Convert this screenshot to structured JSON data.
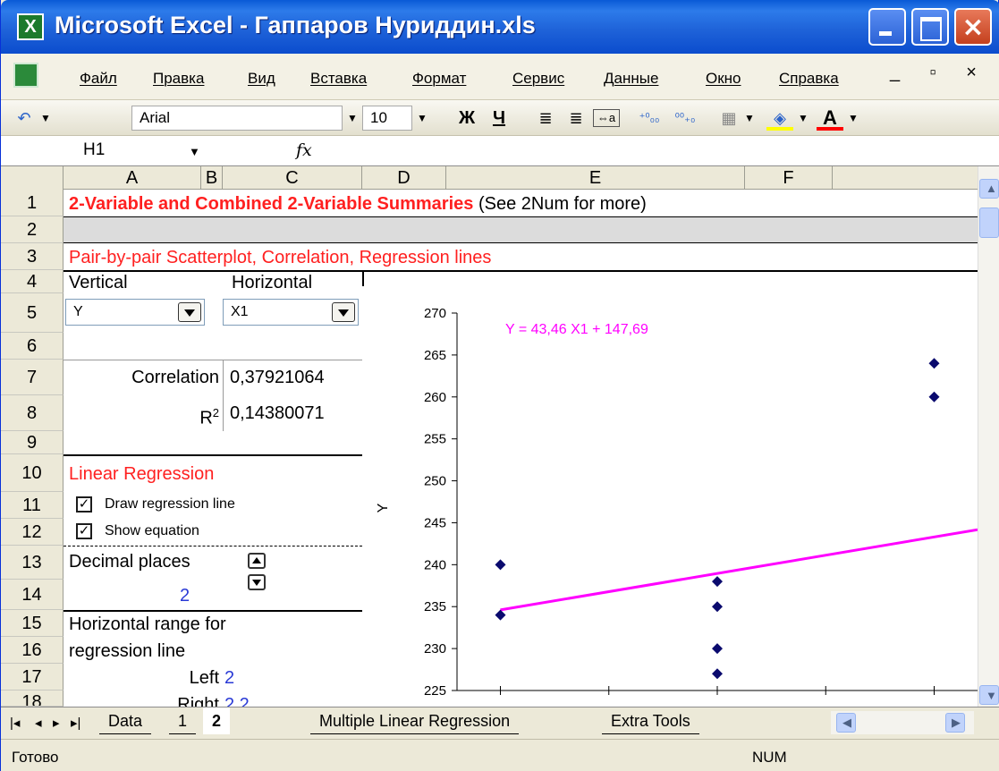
{
  "window": {
    "title": "Microsoft Excel - Гаппаров Нуриддин.xls",
    "icon": "excel-icon"
  },
  "menu": [
    "Файл",
    "Правка",
    "Вид",
    "Вставка",
    "Формат",
    "Сервис",
    "Данные",
    "Окно",
    "Справка"
  ],
  "toolbar": {
    "font": "Arial",
    "size": "10",
    "bold": "Ж",
    "underline": "Ч",
    "dec_more": "⁺⁰₀₀",
    "dec_less": "⁰⁰₊₀"
  },
  "formula": {
    "cell_ref": "H1",
    "fx": "fx",
    "content": ""
  },
  "columns": [
    "A",
    "B",
    "C",
    "D",
    "E",
    "F"
  ],
  "rows": [
    "1",
    "2",
    "3",
    "4",
    "5",
    "6",
    "7",
    "8",
    "9",
    "10",
    "11",
    "12",
    "13",
    "14",
    "15",
    "16",
    "17",
    "18"
  ],
  "cells": {
    "r1_title": "2-Variable and Combined 2-Variable Summaries",
    "r1_note": " (See 2Num for more)",
    "r3": "Pair-by-pair Scatterplot, Correlation, Regression lines",
    "r4_vertical": "Vertical",
    "r4_horizontal": "Horizontal",
    "r5_vertical_value": "Y",
    "r5_horizontal_value": "X1",
    "r7_label": "Correlation",
    "r7_value": "0,37921064",
    "r8_label": "R",
    "r8_sup": "2",
    "r8_value": "0,14380071",
    "r10": "Linear Regression",
    "r11": "Draw regression line",
    "r12": "Show equation",
    "r13": "Decimal places",
    "r14": "2",
    "r15": "Horizontal range for",
    "r16": "regression line",
    "r17_label": "Left",
    "r17_value": "2",
    "r18_label": "Right",
    "r18_value": "2,2"
  },
  "sheet_tabs": [
    "Data",
    "1",
    "2",
    "Multiple Linear Regression",
    "Extra Tools"
  ],
  "active_tab": "2",
  "status": {
    "left": "Готово",
    "num": "NUM"
  },
  "chart_data": {
    "type": "scatter",
    "ylabel": "Y",
    "xlabel": "",
    "ylim": [
      225,
      270
    ],
    "yticks": [
      225,
      230,
      235,
      240,
      245,
      250,
      255,
      260,
      265,
      270
    ],
    "xlim": [
      1.98,
      2.22
    ],
    "equation": "Y = 43,46 X1 + 147,69",
    "series": [
      {
        "x": [
          2,
          2,
          2.1,
          2.1,
          2.1,
          2.1,
          2.2,
          2.2
        ],
        "y": [
          240,
          234,
          238,
          235,
          230,
          227,
          264,
          260
        ]
      }
    ],
    "regression": {
      "slope": 43.46,
      "intercept": 147.69,
      "x_from": 2,
      "x_to": 2.2
    },
    "colors": {
      "points": "#0a0a6e",
      "line": "#ff00ff",
      "title": "#ff2020",
      "equation": "#ff00ff"
    }
  }
}
